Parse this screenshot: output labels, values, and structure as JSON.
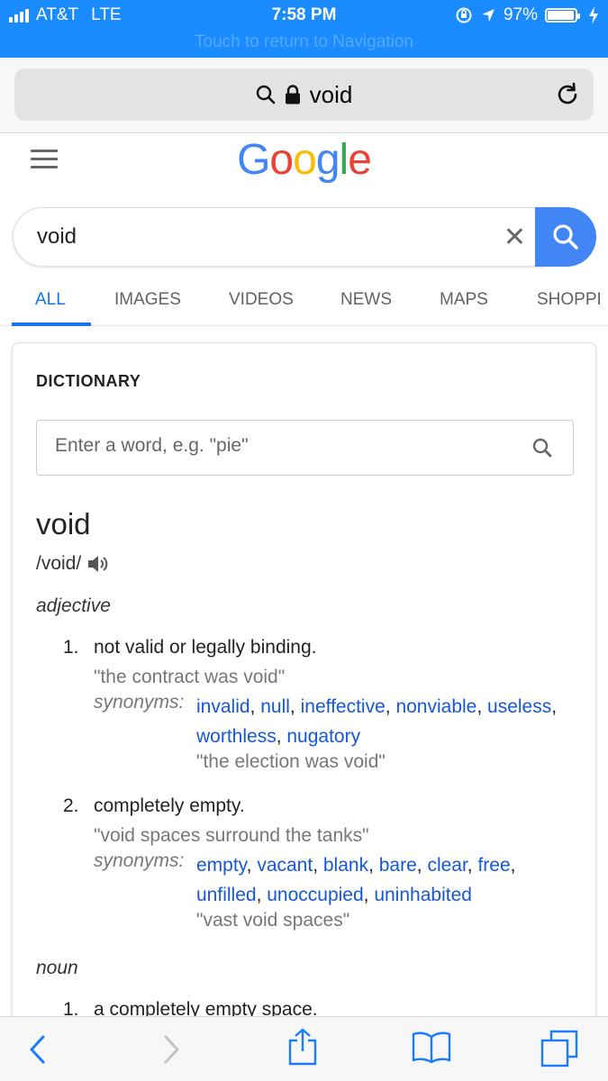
{
  "status": {
    "carrier": "AT&T",
    "network": "LTE",
    "time": "7:58 PM",
    "battery": "97%",
    "battery_level": 0.97,
    "return_banner": "Touch to return to Navigation"
  },
  "browser": {
    "url_text": "void"
  },
  "google": {
    "logo": [
      "G",
      "o",
      "o",
      "g",
      "l",
      "e"
    ],
    "logo_colors": [
      "#4285f4",
      "#ea4335",
      "#fbbc05",
      "#4285f4",
      "#34a853",
      "#ea4335"
    ],
    "query": "void",
    "accent": "#1a73e8"
  },
  "tabs": [
    "ALL",
    "IMAGES",
    "VIDEOS",
    "NEWS",
    "MAPS",
    "SHOPPI"
  ],
  "dictionary": {
    "title": "DICTIONARY",
    "input_placeholder": "Enter a word, e.g. \"pie\"",
    "headword": "void",
    "phonetic": "/void/",
    "pos1": "adjective",
    "senses": [
      {
        "num": "1.",
        "definition": "not valid or legally binding.",
        "example": "\"the contract was void\"",
        "synonyms_label": "synonyms:",
        "synonyms": [
          "invalid",
          "null",
          "ineffective",
          "nonviable",
          "useless",
          "worthless",
          "nugatory"
        ],
        "synonym_example": "\"the election was void\""
      },
      {
        "num": "2.",
        "definition": "completely empty.",
        "example": "\"void spaces surround the tanks\"",
        "synonyms_label": "synonyms:",
        "synonyms": [
          "empty",
          "vacant",
          "blank",
          "bare",
          "clear",
          "free",
          "unfilled",
          "unoccupied",
          "uninhabited"
        ],
        "synonym_example": "\"vast void spaces\""
      }
    ],
    "pos2": "noun",
    "noun_sense": {
      "num": "1.",
      "definition": "a completely empty space."
    }
  },
  "icons": {
    "statusbar": [
      "signal-icon",
      "rotation-lock-icon",
      "location-arrow-icon",
      "battery-icon",
      "charging-bolt-icon"
    ],
    "browser": [
      "search-icon",
      "lock-icon",
      "reload-icon"
    ],
    "toolbar": [
      "back-icon",
      "forward-icon",
      "share-icon",
      "bookmarks-icon",
      "tabs-icon"
    ]
  }
}
